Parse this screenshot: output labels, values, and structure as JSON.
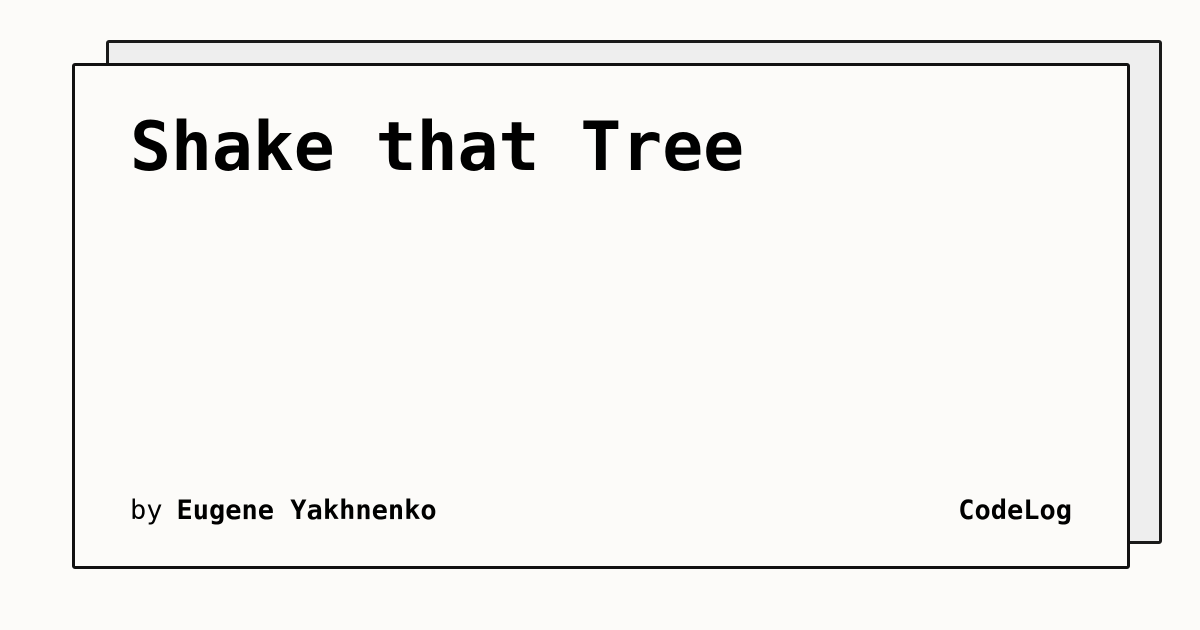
{
  "card": {
    "title": "Shake that Tree",
    "byline_prefix": "by",
    "author": "Eugene Yakhnenko",
    "brand": "CodeLog"
  },
  "colors": {
    "background": "#fcfbf9",
    "shadow_panel": "#eeeeee",
    "border": "#111111",
    "text": "#000000"
  }
}
